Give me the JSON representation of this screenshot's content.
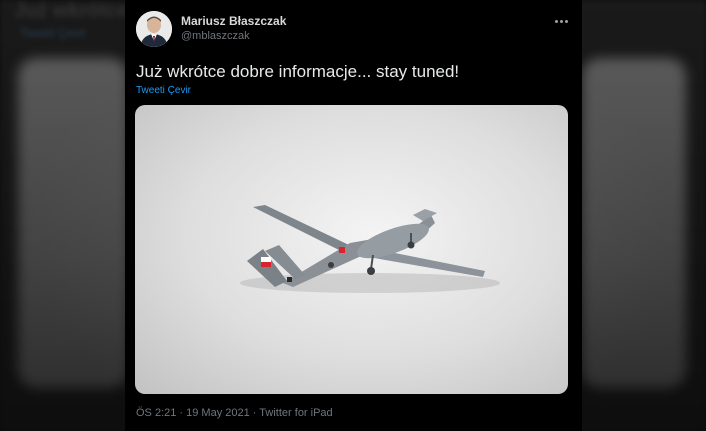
{
  "background": {
    "title": "Już wkrótce",
    "subtitle": "Tweeti Çevir"
  },
  "tweet": {
    "display_name": "Mariusz Błaszczak",
    "handle": "@mblaszczak",
    "text": "Już wkrótce dobre informacje... stay tuned!",
    "translate_label": "Tweeti Çevir",
    "meta": "ÖS 2:21 · 19 May 2021 · Twitter for iPad"
  },
  "icons": {
    "more": "more-horizontal-icon",
    "avatar": "avatar-photo"
  },
  "colors": {
    "background": "#000000",
    "link": "#1d9bf0",
    "primary_text": "#e7e9ea",
    "secondary_text": "#71767b"
  }
}
